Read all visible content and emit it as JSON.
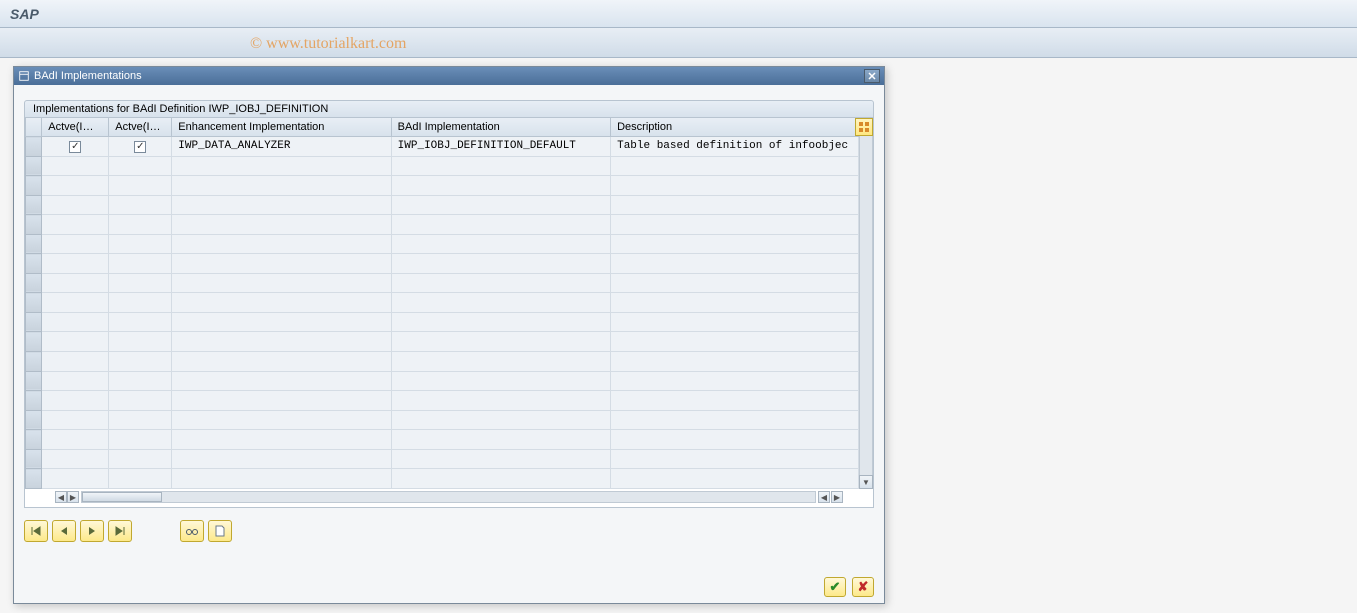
{
  "app": {
    "title": "SAP"
  },
  "watermark": "© www.tutorialkart.com",
  "dialog": {
    "title": "BAdI Implementations",
    "section_title": "Implementations for BAdI Definition IWP_IOBJ_DEFINITION",
    "columns": {
      "rowsel": "",
      "active_img": "Actve(IMG)",
      "active_im": "Actve(Im...",
      "enh_impl": "Enhancement Implementation",
      "badi_impl": "BAdI Implementation",
      "description": "Description"
    },
    "rows": [
      {
        "active_img": true,
        "active_im": true,
        "enh_impl": "IWP_DATA_ANALYZER",
        "badi_impl": "IWP_IOBJ_DEFINITION_DEFAULT",
        "description": "Table based definition of infoobjec"
      }
    ],
    "empty_rows": 17,
    "toolbar": {
      "btn1": "nav-first",
      "btn2": "nav-prev",
      "btn3": "nav-next",
      "btn4": "nav-last",
      "btn5": "display-change",
      "btn6": "create"
    },
    "footer": {
      "ok": "✓",
      "cancel": "✗"
    }
  }
}
